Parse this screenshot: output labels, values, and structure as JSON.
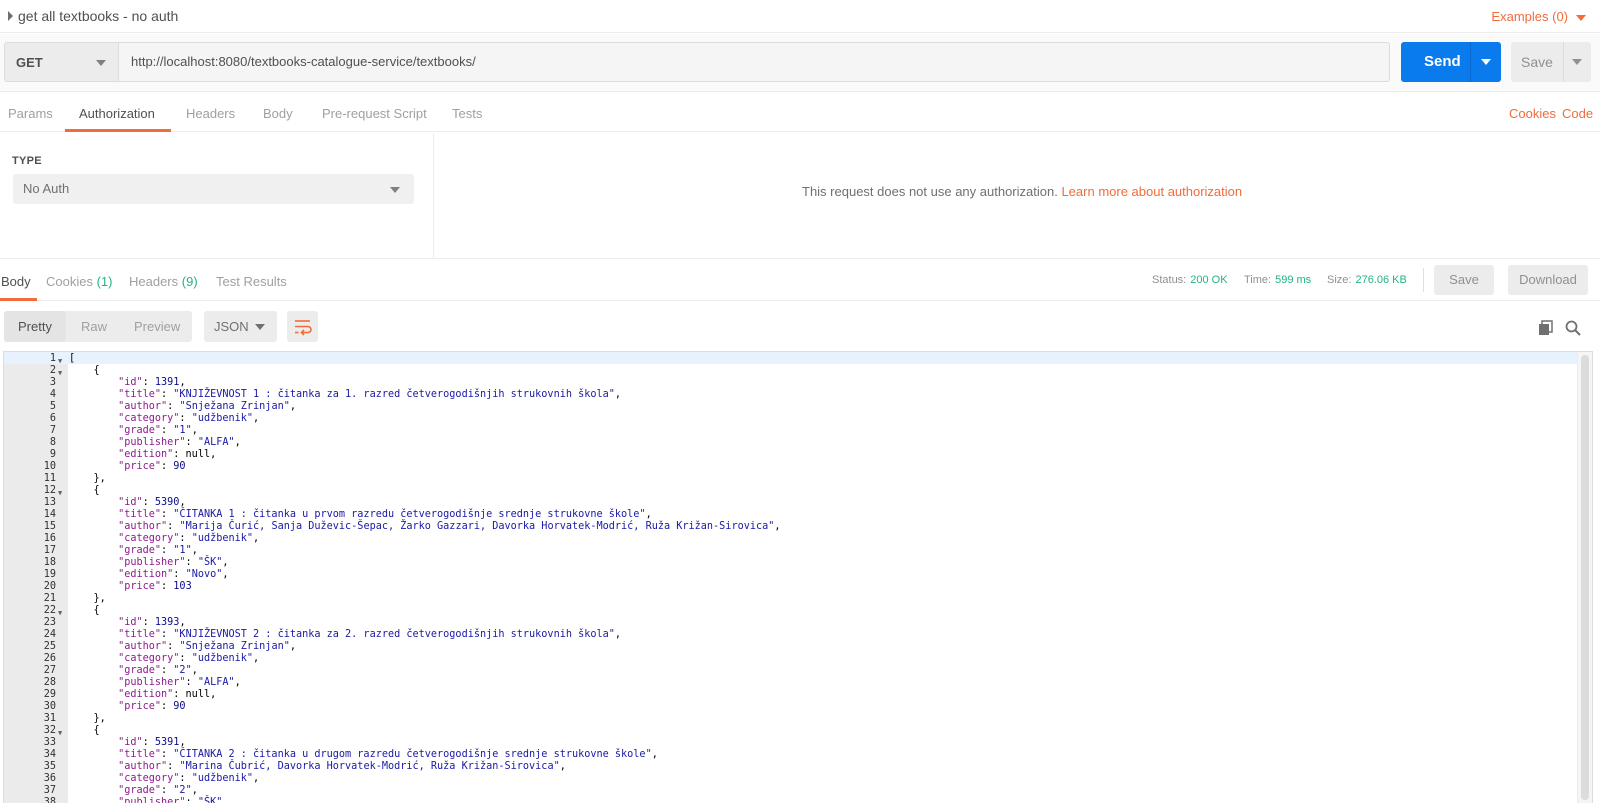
{
  "request": {
    "name": "get all textbooks - no auth",
    "examples_label": "Examples (0)",
    "method": "GET",
    "url": "http://localhost:8080/textbooks-catalogue-service/textbooks/",
    "send_label": "Send",
    "save_label": "Save"
  },
  "request_tabs": [
    "Params",
    "Authorization",
    "Headers",
    "Body",
    "Pre-request Script",
    "Tests"
  ],
  "request_links": {
    "cookies": "Cookies",
    "code": "Code"
  },
  "auth": {
    "type_label": "TYPE",
    "type_value": "No Auth",
    "message": "This request does not use any authorization.",
    "learn_more": "Learn more about authorization"
  },
  "response_tabs": {
    "body": "Body",
    "cookies": "Cookies",
    "cookies_count": "(1)",
    "headers": "Headers",
    "headers_count": "(9)",
    "tests": "Test Results"
  },
  "response_meta": {
    "status_label": "Status:",
    "status_value": "200 OK",
    "time_label": "Time:",
    "time_value": "599 ms",
    "size_label": "Size:",
    "size_value": "276.06 KB",
    "save_label": "Save",
    "download_label": "Download"
  },
  "viewer": {
    "modes": [
      "Pretty",
      "Raw",
      "Preview"
    ],
    "active_mode": "Pretty",
    "format": "JSON",
    "icons": [
      "wrap-lines-icon",
      "copy-icon",
      "search-icon"
    ]
  },
  "colors": {
    "accent": "#f26b3a",
    "send": "#097bed",
    "status_ok": "#26b47f"
  },
  "code_lines": [
    {
      "n": "1",
      "fold": true,
      "parts": [
        [
          "p",
          "["
        ]
      ]
    },
    {
      "n": "2",
      "fold": true,
      "parts": [
        [
          "p",
          "    {"
        ]
      ]
    },
    {
      "n": "3",
      "parts": [
        [
          "p",
          "        "
        ],
        [
          "k",
          "\"id\""
        ],
        [
          "p",
          ": "
        ],
        [
          "n",
          "1391"
        ],
        [
          "p",
          ","
        ]
      ]
    },
    {
      "n": "4",
      "parts": [
        [
          "p",
          "        "
        ],
        [
          "k",
          "\"title\""
        ],
        [
          "p",
          ": "
        ],
        [
          "s",
          "\"KNJIŽEVNOST 1 : čitanka za 1. razred četverogodišnjih strukovnih škola\""
        ],
        [
          "p",
          ","
        ]
      ]
    },
    {
      "n": "5",
      "parts": [
        [
          "p",
          "        "
        ],
        [
          "k",
          "\"author\""
        ],
        [
          "p",
          ": "
        ],
        [
          "s",
          "\"Snježana Zrinjan\""
        ],
        [
          "p",
          ","
        ]
      ]
    },
    {
      "n": "6",
      "parts": [
        [
          "p",
          "        "
        ],
        [
          "k",
          "\"category\""
        ],
        [
          "p",
          ": "
        ],
        [
          "s",
          "\"udžbenik\""
        ],
        [
          "p",
          ","
        ]
      ]
    },
    {
      "n": "7",
      "parts": [
        [
          "p",
          "        "
        ],
        [
          "k",
          "\"grade\""
        ],
        [
          "p",
          ": "
        ],
        [
          "s",
          "\"1\""
        ],
        [
          "p",
          ","
        ]
      ]
    },
    {
      "n": "8",
      "parts": [
        [
          "p",
          "        "
        ],
        [
          "k",
          "\"publisher\""
        ],
        [
          "p",
          ": "
        ],
        [
          "s",
          "\"ALFA\""
        ],
        [
          "p",
          ","
        ]
      ]
    },
    {
      "n": "9",
      "parts": [
        [
          "p",
          "        "
        ],
        [
          "k",
          "\"edition\""
        ],
        [
          "p",
          ": null,"
        ]
      ]
    },
    {
      "n": "10",
      "parts": [
        [
          "p",
          "        "
        ],
        [
          "k",
          "\"price\""
        ],
        [
          "p",
          ": "
        ],
        [
          "n",
          "90"
        ]
      ]
    },
    {
      "n": "11",
      "parts": [
        [
          "p",
          "    },"
        ]
      ]
    },
    {
      "n": "12",
      "fold": true,
      "parts": [
        [
          "p",
          "    {"
        ]
      ]
    },
    {
      "n": "13",
      "parts": [
        [
          "p",
          "        "
        ],
        [
          "k",
          "\"id\""
        ],
        [
          "p",
          ": "
        ],
        [
          "n",
          "5390"
        ],
        [
          "p",
          ","
        ]
      ]
    },
    {
      "n": "14",
      "parts": [
        [
          "p",
          "        "
        ],
        [
          "k",
          "\"title\""
        ],
        [
          "p",
          ": "
        ],
        [
          "s",
          "\"ČITANKA 1 : čitanka u prvom razredu četverogodišnje srednje strukovne škole\""
        ],
        [
          "p",
          ","
        ]
      ]
    },
    {
      "n": "15",
      "parts": [
        [
          "p",
          "        "
        ],
        [
          "k",
          "\"author\""
        ],
        [
          "p",
          ": "
        ],
        [
          "s",
          "\"Marija Čurić, Sanja Duževic-Šepac, Žarko Gazzari, Davorka Horvatek-Modrić, Ruža Križan-Sirovica\""
        ],
        [
          "p",
          ","
        ]
      ]
    },
    {
      "n": "16",
      "parts": [
        [
          "p",
          "        "
        ],
        [
          "k",
          "\"category\""
        ],
        [
          "p",
          ": "
        ],
        [
          "s",
          "\"udžbenik\""
        ],
        [
          "p",
          ","
        ]
      ]
    },
    {
      "n": "17",
      "parts": [
        [
          "p",
          "        "
        ],
        [
          "k",
          "\"grade\""
        ],
        [
          "p",
          ": "
        ],
        [
          "s",
          "\"1\""
        ],
        [
          "p",
          ","
        ]
      ]
    },
    {
      "n": "18",
      "parts": [
        [
          "p",
          "        "
        ],
        [
          "k",
          "\"publisher\""
        ],
        [
          "p",
          ": "
        ],
        [
          "s",
          "\"ŠK\""
        ],
        [
          "p",
          ","
        ]
      ]
    },
    {
      "n": "19",
      "parts": [
        [
          "p",
          "        "
        ],
        [
          "k",
          "\"edition\""
        ],
        [
          "p",
          ": "
        ],
        [
          "s",
          "\"Novo\""
        ],
        [
          "p",
          ","
        ]
      ]
    },
    {
      "n": "20",
      "parts": [
        [
          "p",
          "        "
        ],
        [
          "k",
          "\"price\""
        ],
        [
          "p",
          ": "
        ],
        [
          "n",
          "103"
        ]
      ]
    },
    {
      "n": "21",
      "parts": [
        [
          "p",
          "    },"
        ]
      ]
    },
    {
      "n": "22",
      "fold": true,
      "parts": [
        [
          "p",
          "    {"
        ]
      ]
    },
    {
      "n": "23",
      "parts": [
        [
          "p",
          "        "
        ],
        [
          "k",
          "\"id\""
        ],
        [
          "p",
          ": "
        ],
        [
          "n",
          "1393"
        ],
        [
          "p",
          ","
        ]
      ]
    },
    {
      "n": "24",
      "parts": [
        [
          "p",
          "        "
        ],
        [
          "k",
          "\"title\""
        ],
        [
          "p",
          ": "
        ],
        [
          "s",
          "\"KNJIŽEVNOST 2 : čitanka za 2. razred četverogodišnjih strukovnih škola\""
        ],
        [
          "p",
          ","
        ]
      ]
    },
    {
      "n": "25",
      "parts": [
        [
          "p",
          "        "
        ],
        [
          "k",
          "\"author\""
        ],
        [
          "p",
          ": "
        ],
        [
          "s",
          "\"Snježana Zrinjan\""
        ],
        [
          "p",
          ","
        ]
      ]
    },
    {
      "n": "26",
      "parts": [
        [
          "p",
          "        "
        ],
        [
          "k",
          "\"category\""
        ],
        [
          "p",
          ": "
        ],
        [
          "s",
          "\"udžbenik\""
        ],
        [
          "p",
          ","
        ]
      ]
    },
    {
      "n": "27",
      "parts": [
        [
          "p",
          "        "
        ],
        [
          "k",
          "\"grade\""
        ],
        [
          "p",
          ": "
        ],
        [
          "s",
          "\"2\""
        ],
        [
          "p",
          ","
        ]
      ]
    },
    {
      "n": "28",
      "parts": [
        [
          "p",
          "        "
        ],
        [
          "k",
          "\"publisher\""
        ],
        [
          "p",
          ": "
        ],
        [
          "s",
          "\"ALFA\""
        ],
        [
          "p",
          ","
        ]
      ]
    },
    {
      "n": "29",
      "parts": [
        [
          "p",
          "        "
        ],
        [
          "k",
          "\"edition\""
        ],
        [
          "p",
          ": null,"
        ]
      ]
    },
    {
      "n": "30",
      "parts": [
        [
          "p",
          "        "
        ],
        [
          "k",
          "\"price\""
        ],
        [
          "p",
          ": "
        ],
        [
          "n",
          "90"
        ]
      ]
    },
    {
      "n": "31",
      "parts": [
        [
          "p",
          "    },"
        ]
      ]
    },
    {
      "n": "32",
      "fold": true,
      "parts": [
        [
          "p",
          "    {"
        ]
      ]
    },
    {
      "n": "33",
      "parts": [
        [
          "p",
          "        "
        ],
        [
          "k",
          "\"id\""
        ],
        [
          "p",
          ": "
        ],
        [
          "n",
          "5391"
        ],
        [
          "p",
          ","
        ]
      ]
    },
    {
      "n": "34",
      "parts": [
        [
          "p",
          "        "
        ],
        [
          "k",
          "\"title\""
        ],
        [
          "p",
          ": "
        ],
        [
          "s",
          "\"ČITANKA 2 : čitanka u drugom razredu četverogodišnje srednje strukovne škole\""
        ],
        [
          "p",
          ","
        ]
      ]
    },
    {
      "n": "35",
      "parts": [
        [
          "p",
          "        "
        ],
        [
          "k",
          "\"author\""
        ],
        [
          "p",
          ": "
        ],
        [
          "s",
          "\"Marina Čubrić, Davorka Horvatek-Modrić, Ruža Križan-Sirovica\""
        ],
        [
          "p",
          ","
        ]
      ]
    },
    {
      "n": "36",
      "parts": [
        [
          "p",
          "        "
        ],
        [
          "k",
          "\"category\""
        ],
        [
          "p",
          ": "
        ],
        [
          "s",
          "\"udžbenik\""
        ],
        [
          "p",
          ","
        ]
      ]
    },
    {
      "n": "37",
      "parts": [
        [
          "p",
          "        "
        ],
        [
          "k",
          "\"grade\""
        ],
        [
          "p",
          ": "
        ],
        [
          "s",
          "\"2\""
        ],
        [
          "p",
          ","
        ]
      ]
    },
    {
      "n": "38",
      "parts": [
        [
          "p",
          "        "
        ],
        [
          "k",
          "\"publisher\""
        ],
        [
          "p",
          ": "
        ],
        [
          "s",
          "\"ŠK\""
        ],
        [
          "p",
          ","
        ]
      ]
    }
  ]
}
